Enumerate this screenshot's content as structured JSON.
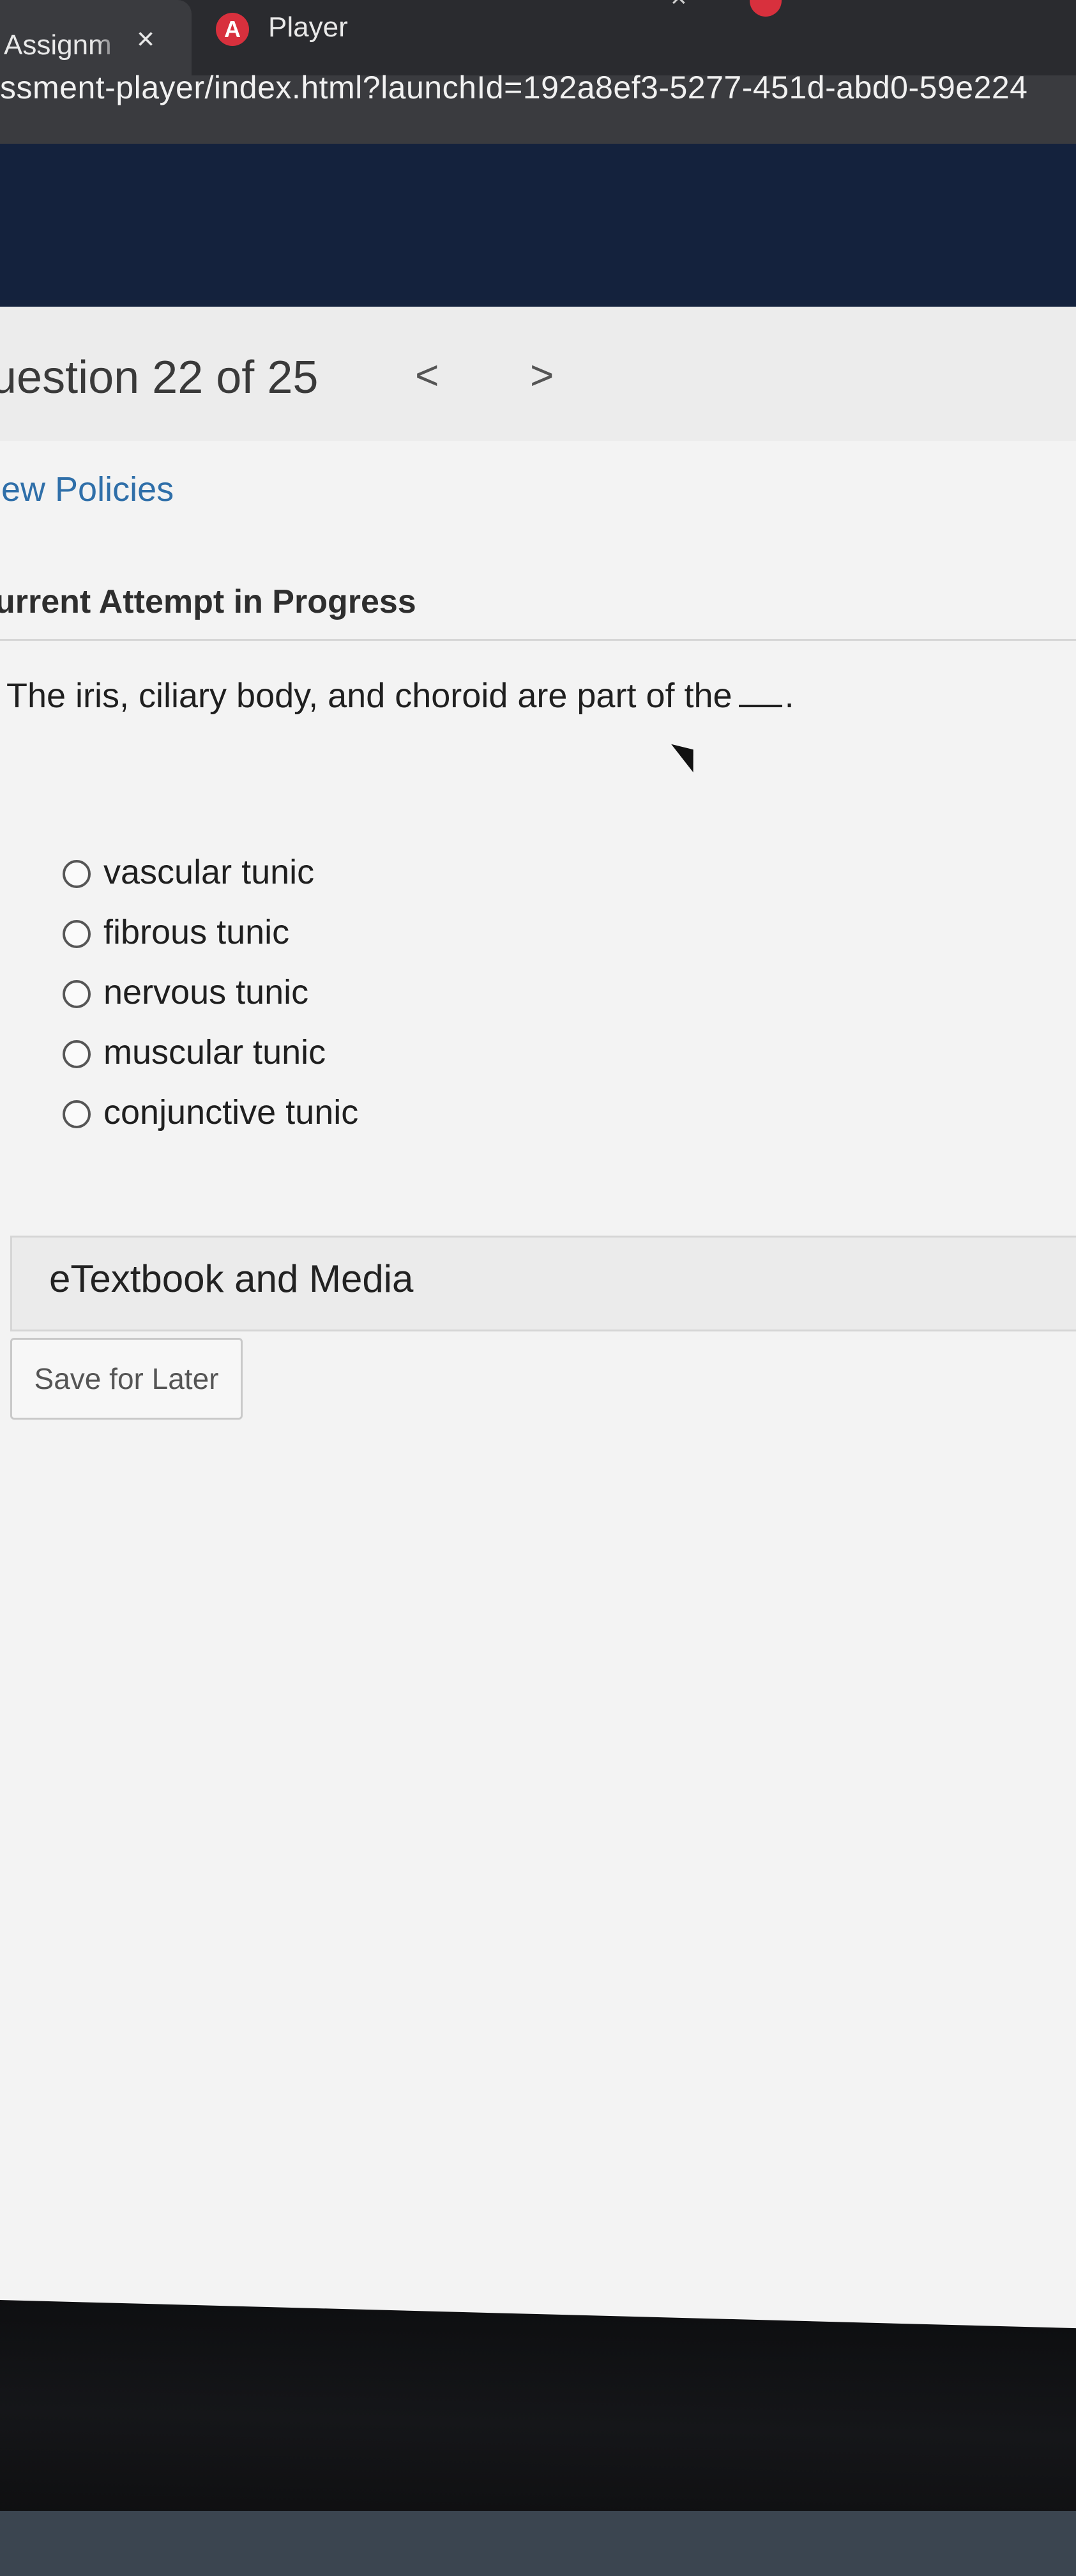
{
  "browser": {
    "active_tab_title": "Assignm",
    "active_tab_close": "×",
    "second_tab_icon": "A",
    "second_tab_title": "Player",
    "third_tab_close": "×",
    "url": "ssment-player/index.html?launchId=192a8ef3-5277-451d-abd0-59e224"
  },
  "question": {
    "title": "uestion 22 of 25",
    "prev_label": "<",
    "next_label": ">",
    "policies_link": "iew Policies",
    "attempt_status": "urrent Attempt in Progress",
    "prompt_before": "The iris, ciliary body, and choroid are part of the",
    "prompt_after": "."
  },
  "options": [
    {
      "label": "vascular tunic",
      "selected": false
    },
    {
      "label": "fibrous tunic",
      "selected": false
    },
    {
      "label": "nervous tunic",
      "selected": false
    },
    {
      "label": "muscular tunic",
      "selected": false
    },
    {
      "label": "conjunctive tunic",
      "selected": false
    }
  ],
  "resources": {
    "etextbook_label": "eTextbook and Media"
  },
  "actions": {
    "save_label": "Save for Later"
  },
  "colors": {
    "header_navy": "#14223d",
    "link_blue": "#2f6fa9",
    "tab_icon_red": "#d8303d"
  },
  "icons": [
    "close-icon",
    "app-logo-icon",
    "chevron-left-icon",
    "chevron-right-icon",
    "radio-icon",
    "mouse-cursor-icon"
  ]
}
